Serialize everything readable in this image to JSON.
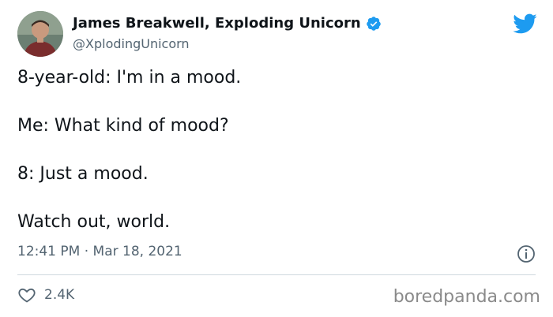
{
  "author": {
    "display_name": "James Breakwell, Exploding Unicorn",
    "handle": "@XplodingUnicorn",
    "verified": true
  },
  "tweet": {
    "lines": [
      "8-year-old: I'm in a mood.",
      "Me: What kind of mood?",
      "8: Just a mood.",
      "Watch out, world."
    ],
    "timestamp": "12:41 PM · Mar 18, 2021",
    "likes": "2.4K"
  },
  "watermark": "boredpanda.com",
  "icons": {
    "brand": "twitter-bird-icon",
    "verified": "verified-badge-icon",
    "info": "info-icon",
    "like": "heart-icon"
  },
  "colors": {
    "twitter_blue": "#1d9bf0",
    "text_primary": "#0f1419",
    "text_secondary": "#536471",
    "divider": "#cfd9de"
  }
}
